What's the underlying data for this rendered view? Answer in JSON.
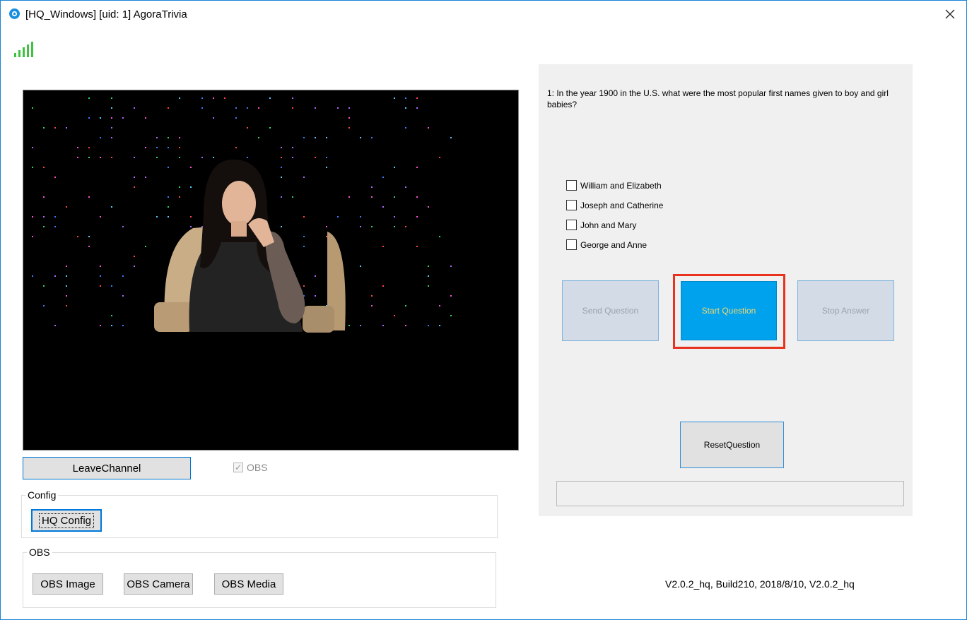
{
  "window": {
    "title": "[HQ_Windows] [uid: 1] AgoraTrivia",
    "close_icon": "close-icon",
    "app_icon": "agora-app-icon"
  },
  "signal": {
    "icon": "signal-strength-icon",
    "color": "#3fc23f"
  },
  "video": {
    "description_icon": "video-feed"
  },
  "controls": {
    "leave_channel": "LeaveChannel",
    "obs_checkbox_label": "OBS",
    "obs_checked": true
  },
  "config_group": {
    "label": "Config",
    "hq_config": "HQ Config"
  },
  "obs_group": {
    "label": "OBS",
    "obs_image": "OBS Image",
    "obs_camera": "OBS Camera",
    "obs_media": "OBS Media"
  },
  "question": {
    "text": "1: In the year 1900 in the U.S. what were the most popular first names given to boy and girl babies?",
    "answers": [
      {
        "label": "William and Elizabeth",
        "checked": false
      },
      {
        "label": "Joseph and Catherine",
        "checked": false
      },
      {
        "label": "John and Mary",
        "checked": false
      },
      {
        "label": "George and Anne",
        "checked": false
      }
    ]
  },
  "actions": {
    "send_question": "Send Question",
    "start_question": "Start Question",
    "stop_answer": "Stop Answer",
    "reset_question": "ResetQuestion"
  },
  "colors": {
    "accent": "#00a2ed",
    "highlight": "#e8321e",
    "start_text": "#f5d76e",
    "panel_bg": "#f0f0f0"
  },
  "footer": {
    "version": "V2.0.2_hq, Build210, 2018/8/10, V2.0.2_hq"
  }
}
